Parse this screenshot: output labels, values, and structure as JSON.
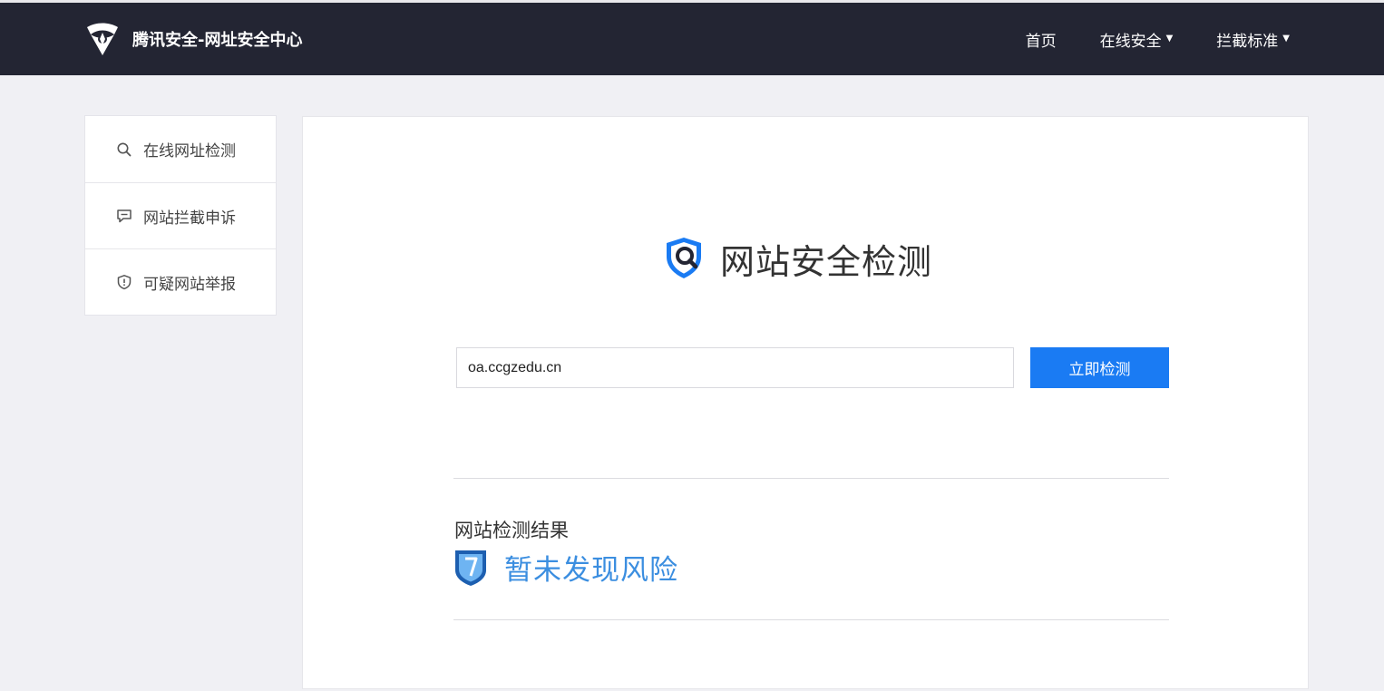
{
  "header": {
    "brand": "腾讯安全-网址安全中心",
    "nav": [
      {
        "label": "首页",
        "dropdown": false
      },
      {
        "label": "在线安全",
        "dropdown": true
      },
      {
        "label": "拦截标准",
        "dropdown": true
      }
    ]
  },
  "sidebar": {
    "items": [
      {
        "label": "在线网址检测",
        "icon": "search-icon"
      },
      {
        "label": "网站拦截申诉",
        "icon": "message-icon"
      },
      {
        "label": "可疑网站举报",
        "icon": "shield-alert-icon"
      }
    ]
  },
  "main": {
    "title": "网站安全检测",
    "input_value": "oa.ccgzedu.cn",
    "button_label": "立即检测",
    "result_label": "网站检测结果",
    "result_status": "暂未发现风险"
  },
  "colors": {
    "topbar": "#232533",
    "accent": "#1a7bf3",
    "result": "#3b8ee0"
  }
}
